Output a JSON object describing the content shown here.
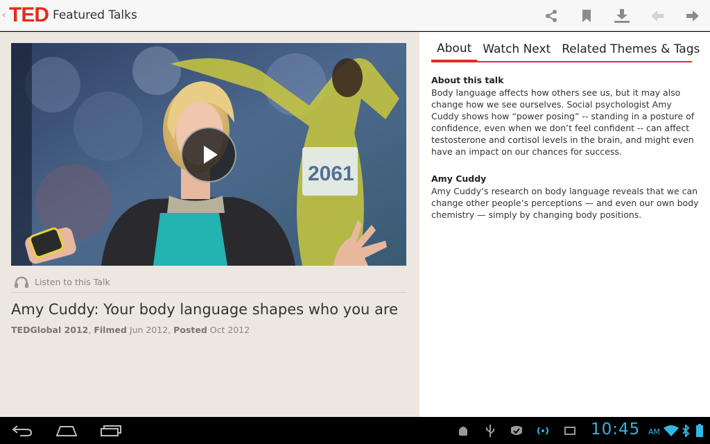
{
  "action_bar": {
    "logo": "TED",
    "title": "Featured Talks",
    "actions": [
      "share-icon",
      "bookmark-icon",
      "download-icon",
      "previous-icon",
      "next-icon"
    ]
  },
  "talk": {
    "listen_label": "Listen to this Talk",
    "title": "Amy Cuddy: Your body language shapes who you are",
    "event": "TEDGlobal 2012",
    "filmed_label": "Filmed",
    "filmed_value": "Jun 2012",
    "posted_label": "Posted",
    "posted_value": "Oct 2012",
    "bib_number": "2061"
  },
  "tabs": [
    {
      "label": "About",
      "active": true
    },
    {
      "label": "Watch Next",
      "active": false
    },
    {
      "label": "Related Themes & Tags",
      "active": false
    }
  ],
  "about": {
    "heading": "About this talk",
    "body": "Body language affects how others see us, but it may also change how we see ourselves. Social psychologist Amy Cuddy shows how “power posing” -- standing in a posture of confidence, even when we don’t feel confident -- can affect testosterone and cortisol levels in the brain, and might even have an impact on our chances for success."
  },
  "speaker": {
    "heading": "Amy Cuddy",
    "body": "Amy Cuddy’s research on body language reveals that we can change other people’s perceptions — and even our own body chemistry — simply by changing body positions."
  },
  "system_bar": {
    "time": "10:45",
    "ampm": "AM"
  },
  "colors": {
    "accent": "#e62b1e",
    "clock": "#33b5e5"
  }
}
